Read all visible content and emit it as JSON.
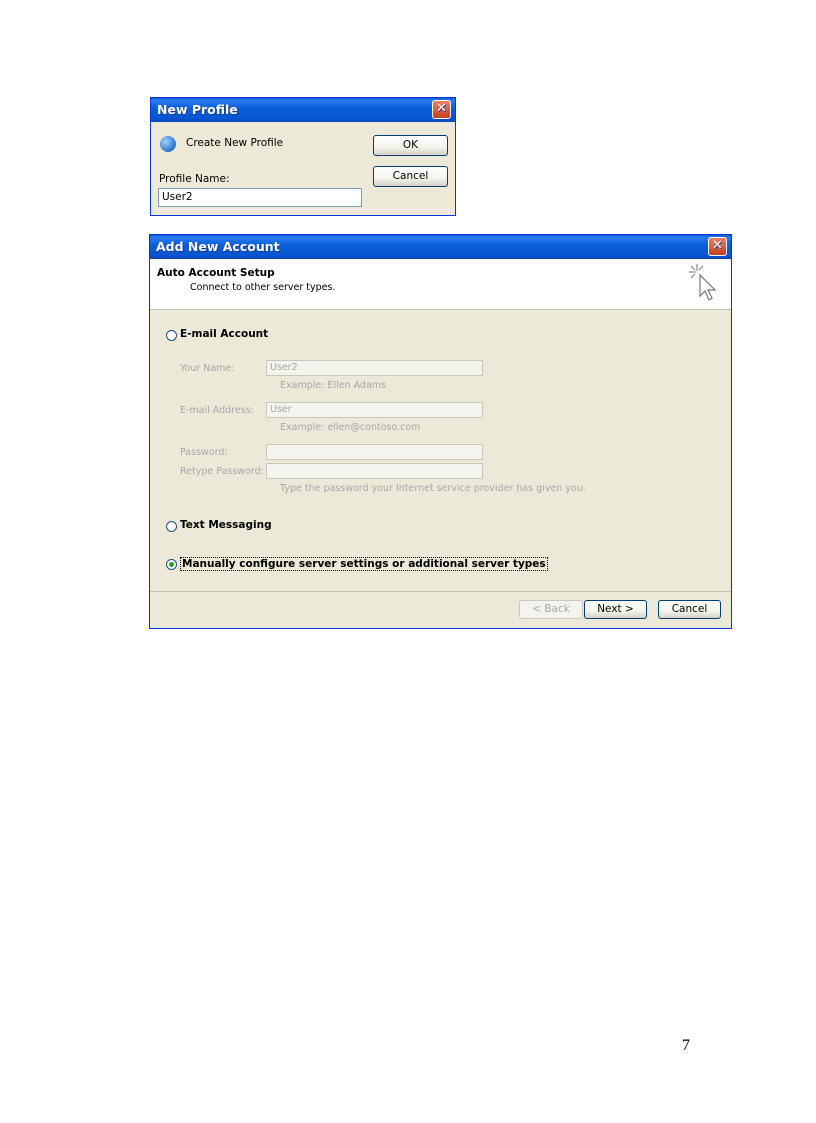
{
  "new_profile": {
    "title": "New Profile",
    "close_label": "✕",
    "caption": "Create New Profile",
    "ok_label": "OK",
    "cancel_label": "Cancel",
    "name_label": "Profile Name:",
    "name_value": "User2"
  },
  "add_account": {
    "title": "Add New Account",
    "close_label": "✕",
    "header_title": "Auto Account Setup",
    "header_subtitle": "Connect to other server types.",
    "options": {
      "email": "E-mail Account",
      "text": "Text Messaging",
      "manual": "Manually configure server settings or additional server types"
    },
    "selected_option": "manual",
    "fields": {
      "your_name_label": "Your Name:",
      "your_name_value": "User2",
      "your_name_hint": "Example: Ellen Adams",
      "email_label": "E-mail Address:",
      "email_value": "User",
      "email_hint": "Example: ellen@contoso.com",
      "password_label": "Password:",
      "retype_label": "Retype Password:",
      "password_hint": "Type the password your Internet service provider has given you."
    },
    "buttons": {
      "back": "< Back",
      "next": "Next >",
      "cancel": "Cancel"
    }
  },
  "page_number": "7",
  "colors": {
    "titlebar": "#0654d0",
    "dialog_bg": "#ece9d8",
    "close_button": "#c2401f",
    "selected_radio": "#21a121"
  },
  "icons": [
    "profile-globe-icon",
    "wizard-cursor-icon",
    "close-icon"
  ]
}
